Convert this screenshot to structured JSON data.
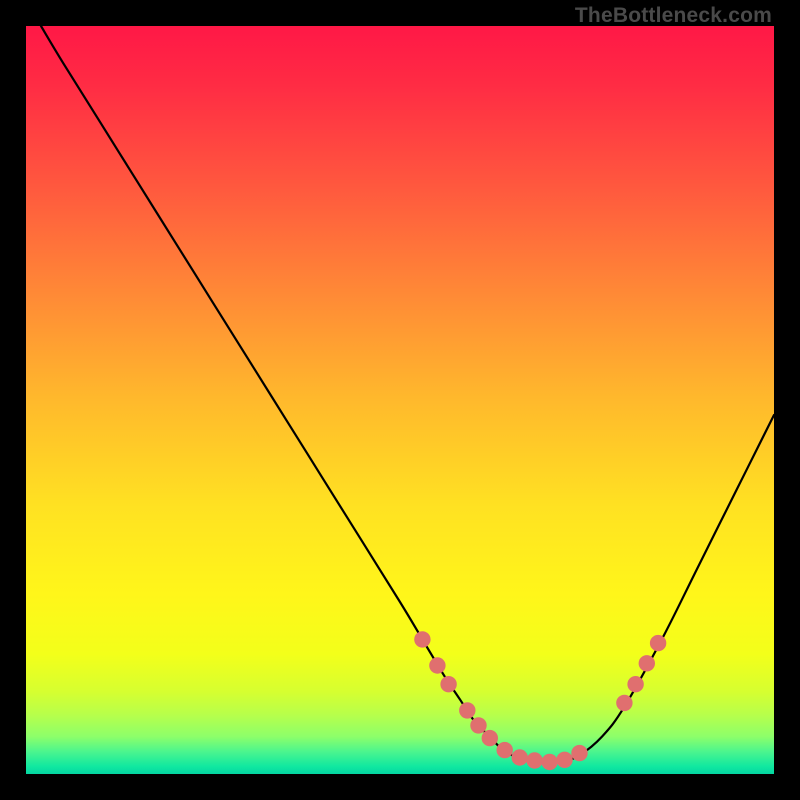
{
  "watermark": "TheBottleneck.com",
  "colors": {
    "background": "#000000",
    "curve": "#000000",
    "dots": "#e06f6f",
    "gradient_top": "#ff1846",
    "gradient_bottom": "#04d6a2"
  },
  "chart_data": {
    "type": "line",
    "title": "",
    "xlabel": "",
    "ylabel": "",
    "xlim": [
      0,
      100
    ],
    "ylim": [
      0,
      100
    ],
    "grid": false,
    "legend": false,
    "series": [
      {
        "name": "bottleneck-curve",
        "x": [
          2,
          5,
          10,
          15,
          20,
          25,
          30,
          35,
          40,
          45,
          50,
          53,
          56,
          58,
          60,
          62,
          64,
          66,
          68,
          70,
          72,
          74,
          77,
          80,
          85,
          90,
          95,
          100
        ],
        "y": [
          100,
          95,
          87,
          79,
          71,
          63,
          55,
          47,
          39,
          31,
          23,
          18,
          13,
          10,
          7,
          5,
          3,
          2.2,
          1.8,
          1.6,
          1.8,
          2.5,
          5,
          9,
          18,
          28,
          38,
          48
        ]
      }
    ],
    "markers": [
      {
        "x": 53,
        "y": 18
      },
      {
        "x": 55,
        "y": 14.5
      },
      {
        "x": 56.5,
        "y": 12
      },
      {
        "x": 59,
        "y": 8.5
      },
      {
        "x": 60.5,
        "y": 6.5
      },
      {
        "x": 62,
        "y": 4.8
      },
      {
        "x": 64,
        "y": 3.2
      },
      {
        "x": 66,
        "y": 2.2
      },
      {
        "x": 68,
        "y": 1.8
      },
      {
        "x": 70,
        "y": 1.6
      },
      {
        "x": 72,
        "y": 1.9
      },
      {
        "x": 74,
        "y": 2.8
      },
      {
        "x": 80,
        "y": 9.5
      },
      {
        "x": 81.5,
        "y": 12
      },
      {
        "x": 83,
        "y": 14.8
      },
      {
        "x": 84.5,
        "y": 17.5
      }
    ]
  }
}
